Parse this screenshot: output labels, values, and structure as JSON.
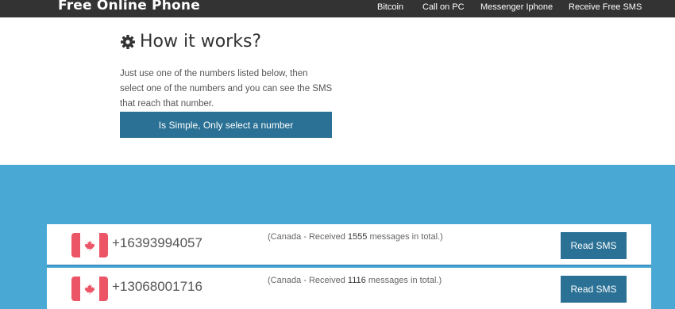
{
  "navbar": {
    "brand": "Free Online Phone",
    "links": [
      "Bitcoin",
      "Call on PC",
      "Messenger Iphone",
      "Receive Free SMS"
    ]
  },
  "how_it_works": {
    "title": "How it works?",
    "icon": "gear-icon",
    "lines": [
      "Just use one of the numbers listed below, then",
      "select one of the numbers and you can see the SMS",
      "that reach that number."
    ],
    "cta_label": "Is Simple, Only select a number"
  },
  "numbers": [
    {
      "flag": "canada-flag-icon",
      "phone": "+16393994057",
      "prefix": "(Canada - Received",
      "count": "1555",
      "suffix": "messages in total.)",
      "button": "Read SMS"
    },
    {
      "flag": "canada-flag-icon",
      "phone": "+13068001716",
      "prefix": "(Canada - Received",
      "count": "1116",
      "suffix": "messages in total.)",
      "button": "Read SMS"
    }
  ],
  "colors": {
    "navbar": "#333333",
    "accent_button": "#2a7195",
    "band": "#4aa8d4",
    "flag_red": "#ec5565"
  }
}
